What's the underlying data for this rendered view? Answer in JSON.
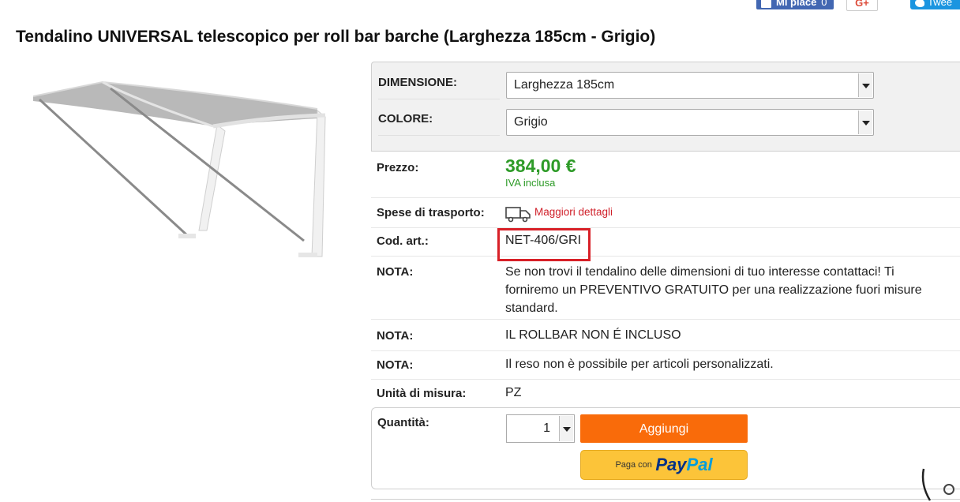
{
  "social": {
    "like_label": "Mi piace",
    "like_count": "0",
    "gplus_label": "G+",
    "tweet_label": "Twee"
  },
  "product": {
    "title": "Tendalino UNIVERSAL telescopico per roll bar barche (Larghezza 185cm - Grigio)"
  },
  "options": {
    "dimension_label": "DIMENSIONE:",
    "dimension_value": "Larghezza 185cm",
    "color_label": "COLORE:",
    "color_value": "Grigio"
  },
  "details": {
    "price_label": "Prezzo:",
    "price_value": "384,00 €",
    "vat_note": "IVA inclusa",
    "shipping_label": "Spese di trasporto:",
    "shipping_link": "Maggiori dettagli",
    "code_label": "Cod. art.:",
    "code_value": "NET-406/GRI",
    "notes": [
      {
        "label": "NOTA:",
        "text": "Se non trovi il tendalino delle dimensioni di tuo interesse contattaci! Ti forniremo un PREVENTIVO GRATUITO per una realizzazione fuori misure standard."
      },
      {
        "label": "NOTA:",
        "text": "IL ROLLBAR NON É INCLUSO"
      },
      {
        "label": "NOTA:",
        "text": "Il reso non è possibile per articoli personalizzati."
      }
    ],
    "unit_label": "Unità di misura:",
    "unit_value": "PZ"
  },
  "purchase": {
    "quantity_label": "Quantità:",
    "quantity_value": "1",
    "add_button": "Aggiungi",
    "paypal_prefix": "Paga con",
    "paypal_brand_a": "Pay",
    "paypal_brand_b": "Pal"
  },
  "colors": {
    "price_green": "#2e9b28",
    "link_red": "#d0202a",
    "add_orange": "#f96b0a",
    "paypal_yellow": "#fcc439",
    "highlight_red": "#d82027"
  }
}
